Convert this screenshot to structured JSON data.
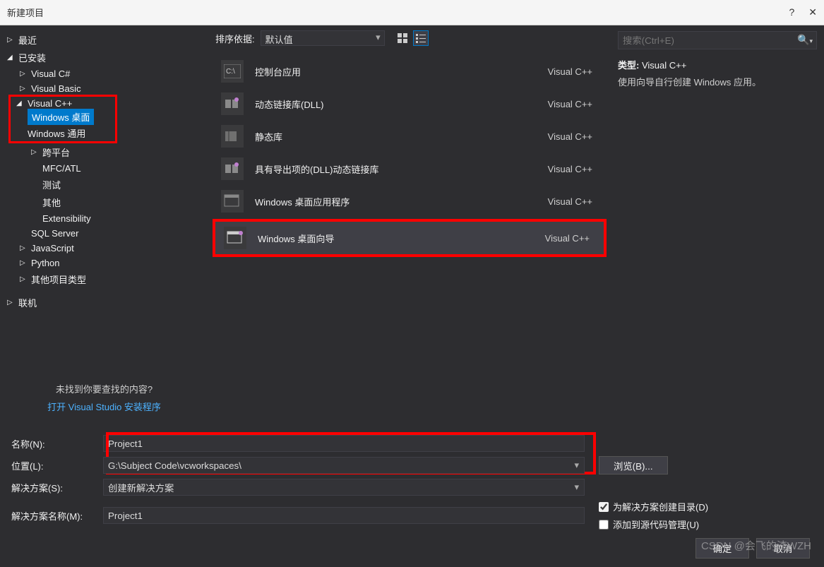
{
  "window": {
    "title": "新建项目",
    "help": "?",
    "close": "✕"
  },
  "sidebar": {
    "recent": "最近",
    "installed": "已安装",
    "items": [
      {
        "label": "Visual C#"
      },
      {
        "label": "Visual Basic"
      },
      {
        "label": "Visual C++",
        "children": [
          {
            "label": "Windows 桌面",
            "selected": true
          },
          {
            "label": "Windows 通用"
          },
          {
            "label": "跨平台"
          },
          {
            "label": "MFC/ATL"
          },
          {
            "label": "测试"
          },
          {
            "label": "其他"
          },
          {
            "label": "Extensibility"
          }
        ]
      },
      {
        "label": "SQL Server"
      },
      {
        "label": "JavaScript"
      },
      {
        "label": "Python"
      },
      {
        "label": "其他项目类型"
      }
    ],
    "online": "联机",
    "notfound": "未找到你要查找的内容?",
    "openInstaller": "打开 Visual Studio 安装程序"
  },
  "toolbar": {
    "sort_label": "排序依据:",
    "sort_value": "默认值"
  },
  "templates": [
    {
      "name": "控制台应用",
      "lang": "Visual C++"
    },
    {
      "name": "动态链接库(DLL)",
      "lang": "Visual C++"
    },
    {
      "name": "静态库",
      "lang": "Visual C++"
    },
    {
      "name": "具有导出项的(DLL)动态链接库",
      "lang": "Visual C++"
    },
    {
      "name": "Windows 桌面应用程序",
      "lang": "Visual C++"
    },
    {
      "name": "Windows 桌面向导",
      "lang": "Visual C++",
      "selected": true,
      "highlighted": true
    }
  ],
  "search": {
    "placeholder": "搜索(Ctrl+E)"
  },
  "info": {
    "type_label": "类型:",
    "type_value": "Visual C++",
    "desc": "使用向导自行创建 Windows 应用。"
  },
  "form": {
    "name_label": "名称(N):",
    "name_value": "Project1",
    "location_label": "位置(L):",
    "location_value": "G:\\Subject Code\\vcworkspaces\\",
    "browse": "浏览(B)...",
    "solution_label": "解决方案(S):",
    "solution_value": "创建新解决方案",
    "solution_name_label": "解决方案名称(M):",
    "solution_name_value": "Project1",
    "create_dir": "为解决方案创建目录(D)",
    "add_src": "添加到源代码管理(U)",
    "ok": "确定",
    "cancel": "取消"
  },
  "watermark": "CSDN @会飞的渣WZH"
}
